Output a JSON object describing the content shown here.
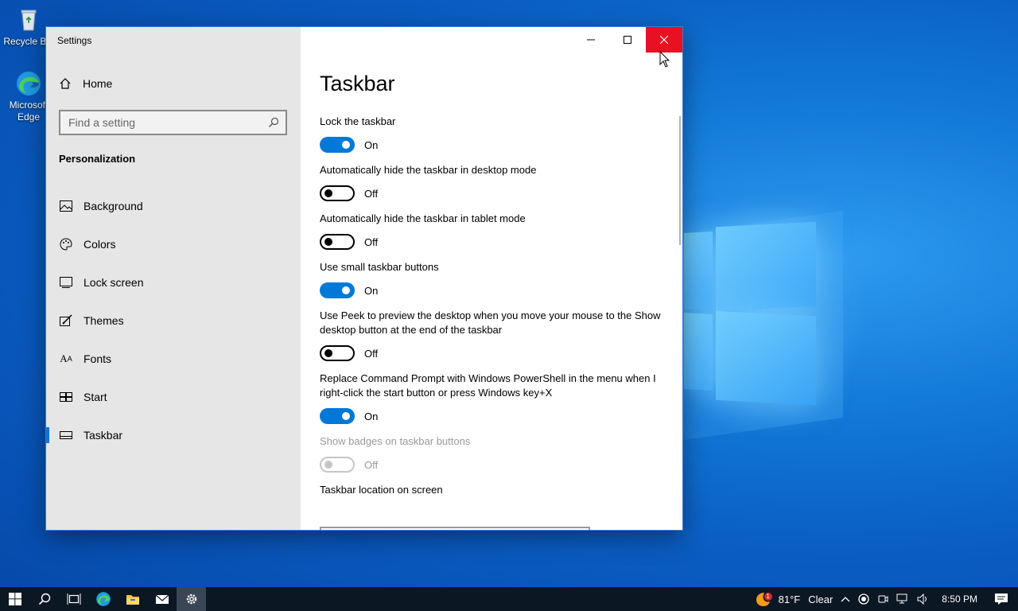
{
  "desktop": {
    "icons": [
      {
        "label": "Recycle Bin",
        "icon": "recycle-bin-icon"
      },
      {
        "label": "Microsoft Edge",
        "icon": "edge-icon"
      }
    ]
  },
  "window": {
    "title": "Settings",
    "controls": {
      "minimize": "minimize-icon",
      "maximize": "maximize-icon",
      "close": "close-icon"
    }
  },
  "sidebar": {
    "home_label": "Home",
    "search_placeholder": "Find a setting",
    "section_title": "Personalization",
    "items": [
      {
        "label": "Background",
        "icon": "image-icon"
      },
      {
        "label": "Colors",
        "icon": "palette-icon"
      },
      {
        "label": "Lock screen",
        "icon": "lock-screen-icon"
      },
      {
        "label": "Themes",
        "icon": "themes-icon"
      },
      {
        "label": "Fonts",
        "icon": "fonts-icon"
      },
      {
        "label": "Start",
        "icon": "start-icon"
      },
      {
        "label": "Taskbar",
        "icon": "taskbar-icon",
        "active": true
      }
    ]
  },
  "content": {
    "page_title": "Taskbar",
    "settings": [
      {
        "label": "Lock the taskbar",
        "state": "On"
      },
      {
        "label": "Automatically hide the taskbar in desktop mode",
        "state": "Off"
      },
      {
        "label": "Automatically hide the taskbar in tablet mode",
        "state": "Off"
      },
      {
        "label": "Use small taskbar buttons",
        "state": "On"
      },
      {
        "label": "Use Peek to preview the desktop when you move your mouse to the Show desktop button at the end of the taskbar",
        "state": "Off"
      },
      {
        "label": "Replace Command Prompt with Windows PowerShell in the menu when I right-click the start button or press Windows key+X",
        "state": "On"
      },
      {
        "label": "Show badges on taskbar buttons",
        "state": "Off",
        "disabled": true
      }
    ],
    "next_label": "Taskbar location on screen"
  },
  "taskbar": {
    "apps": [
      "windows-start-icon",
      "search-icon",
      "task-view-icon",
      "edge-icon",
      "file-explorer-icon",
      "mail-icon",
      "settings-icon"
    ],
    "tray": {
      "weather_badge": "1",
      "temperature": "81°F",
      "condition": "Clear",
      "time": "8:50 PM"
    }
  }
}
